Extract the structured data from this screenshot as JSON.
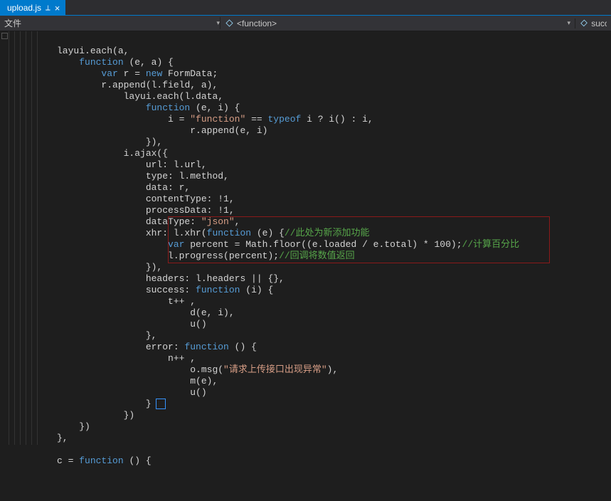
{
  "tab": {
    "filename": "upload.js",
    "pin_icon": "📌",
    "close_icon": "×"
  },
  "toolbar": {
    "left_label": "文件",
    "mid_label": "<function>",
    "right_label": "succ"
  },
  "code": {
    "l01a": "layui.",
    "l01b": "each",
    "l01c": "(a,",
    "l02a": "function",
    "l02b": " (e, a) {",
    "l03a": "var",
    "l03b": " r = ",
    "l03c": "new",
    "l03d": " FormData;",
    "l04": "r.append(l.field, a),",
    "l05": "layui.each(l.data,",
    "l06a": "function",
    "l06b": " (e, i) {",
    "l07a": "i = ",
    "l07b": "\"function\"",
    "l07c": " == ",
    "l07d": "typeof",
    "l07e": " i ? i() : i,",
    "l08": "r.append(e, i)",
    "l09": "}),",
    "l10": "i.ajax({",
    "l11": "url: l.url,",
    "l12": "type: l.method,",
    "l13": "data: r,",
    "l14": "contentType: !1,",
    "l15": "processData: !1,",
    "l16a": "dataType: ",
    "l16b": "\"json\"",
    "l16c": ",",
    "l17a": "xhr: l.xhr(",
    "l17b": "function",
    "l17c": " (e) {",
    "l17d": "//此处为新添加功能",
    "l18a": "var",
    "l18b": " percent = Math.floor((e.loaded / e.total) * 100);",
    "l18c": "//计算百分比",
    "l19a": "l.progress(percent);",
    "l19b": "//回调将数值返回",
    "l20": "}),",
    "l21": "headers: l.headers || {},",
    "l22a": "success: ",
    "l22b": "function",
    "l22c": " (i) {",
    "l23": "t++ ,",
    "l24": "d(e, i),",
    "l25": "u()",
    "l26": "},",
    "l27a": "error: ",
    "l27b": "function",
    "l27c": " () {",
    "l28": "n++ ,",
    "l29a": "o.msg(",
    "l29b": "\"请求上传接口出现异常\"",
    "l29c": "),",
    "l30": "m(e),",
    "l31": "u()",
    "l32": "}",
    "l33": "})",
    "l34": "})",
    "l35": "},",
    "l36a": "c = ",
    "l36b": "function",
    "l36c": " () {"
  }
}
